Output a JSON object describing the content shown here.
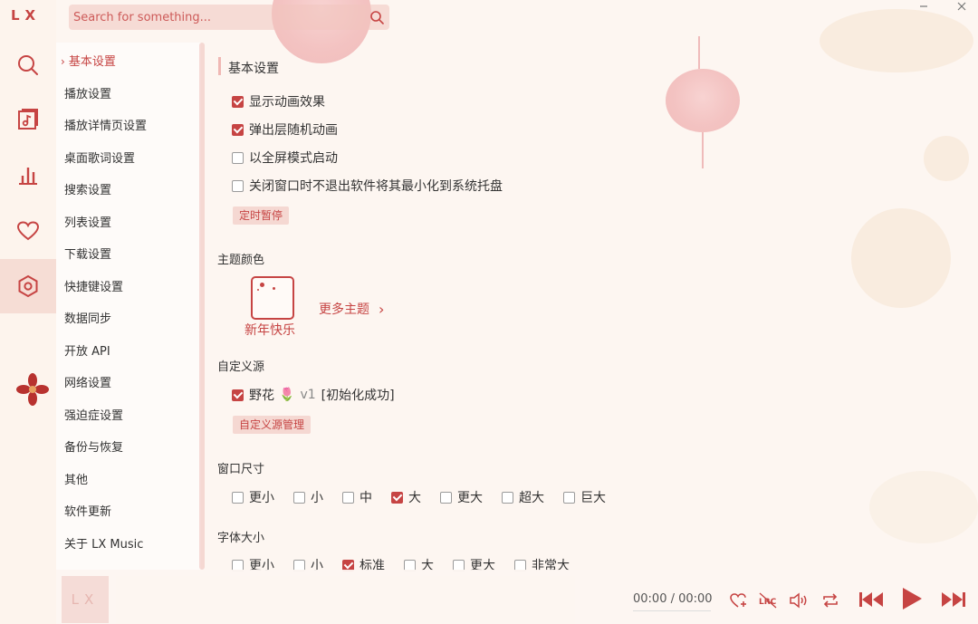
{
  "app": {
    "logo": "LX"
  },
  "search": {
    "placeholder": "Search for something..."
  },
  "rail": {
    "items": [
      {
        "name": "search-icon"
      },
      {
        "name": "song-list-icon"
      },
      {
        "name": "chart-icon"
      },
      {
        "name": "heart-icon"
      },
      {
        "name": "settings-icon",
        "active": true
      }
    ]
  },
  "nav": {
    "items": [
      "基本设置",
      "播放设置",
      "播放详情页设置",
      "桌面歌词设置",
      "搜索设置",
      "列表设置",
      "下载设置",
      "快捷键设置",
      "数据同步",
      "开放 API",
      "网络设置",
      "强迫症设置",
      "备份与恢复",
      "其他",
      "软件更新",
      "关于 LX Music"
    ],
    "active_index": 0
  },
  "basic": {
    "title": "基本设置",
    "options": [
      {
        "label": "显示动画效果",
        "checked": true
      },
      {
        "label": "弹出层随机动画",
        "checked": true
      },
      {
        "label": "以全屏模式启动",
        "checked": false
      },
      {
        "label": "关闭窗口时不退出软件将其最小化到系统托盘",
        "checked": false
      }
    ],
    "timer_button": "定时暂停"
  },
  "theme": {
    "title": "主题颜色",
    "current": "新年快乐",
    "more": "更多主题"
  },
  "source": {
    "title": "自定义源",
    "name": "野花",
    "emoji": "🌷",
    "version": "v1",
    "status": "[初始化成功]",
    "checked": true,
    "manage_button": "自定义源管理"
  },
  "window_size": {
    "title": "窗口尺寸",
    "options": [
      {
        "label": "更小",
        "checked": false
      },
      {
        "label": "小",
        "checked": false
      },
      {
        "label": "中",
        "checked": false
      },
      {
        "label": "大",
        "checked": true
      },
      {
        "label": "更大",
        "checked": false
      },
      {
        "label": "超大",
        "checked": false
      },
      {
        "label": "巨大",
        "checked": false
      }
    ]
  },
  "font_size": {
    "title": "字体大小",
    "options": [
      {
        "label": "更小",
        "checked": false
      },
      {
        "label": "小",
        "checked": false
      },
      {
        "label": "标准",
        "checked": true
      },
      {
        "label": "大",
        "checked": false
      },
      {
        "label": "更大",
        "checked": false
      },
      {
        "label": "非常大",
        "checked": false
      }
    ]
  },
  "player": {
    "cover_text": "LX",
    "time": "00:00 / 00:00"
  },
  "colors": {
    "accent": "#c64443",
    "soft": "#f0c4be"
  }
}
